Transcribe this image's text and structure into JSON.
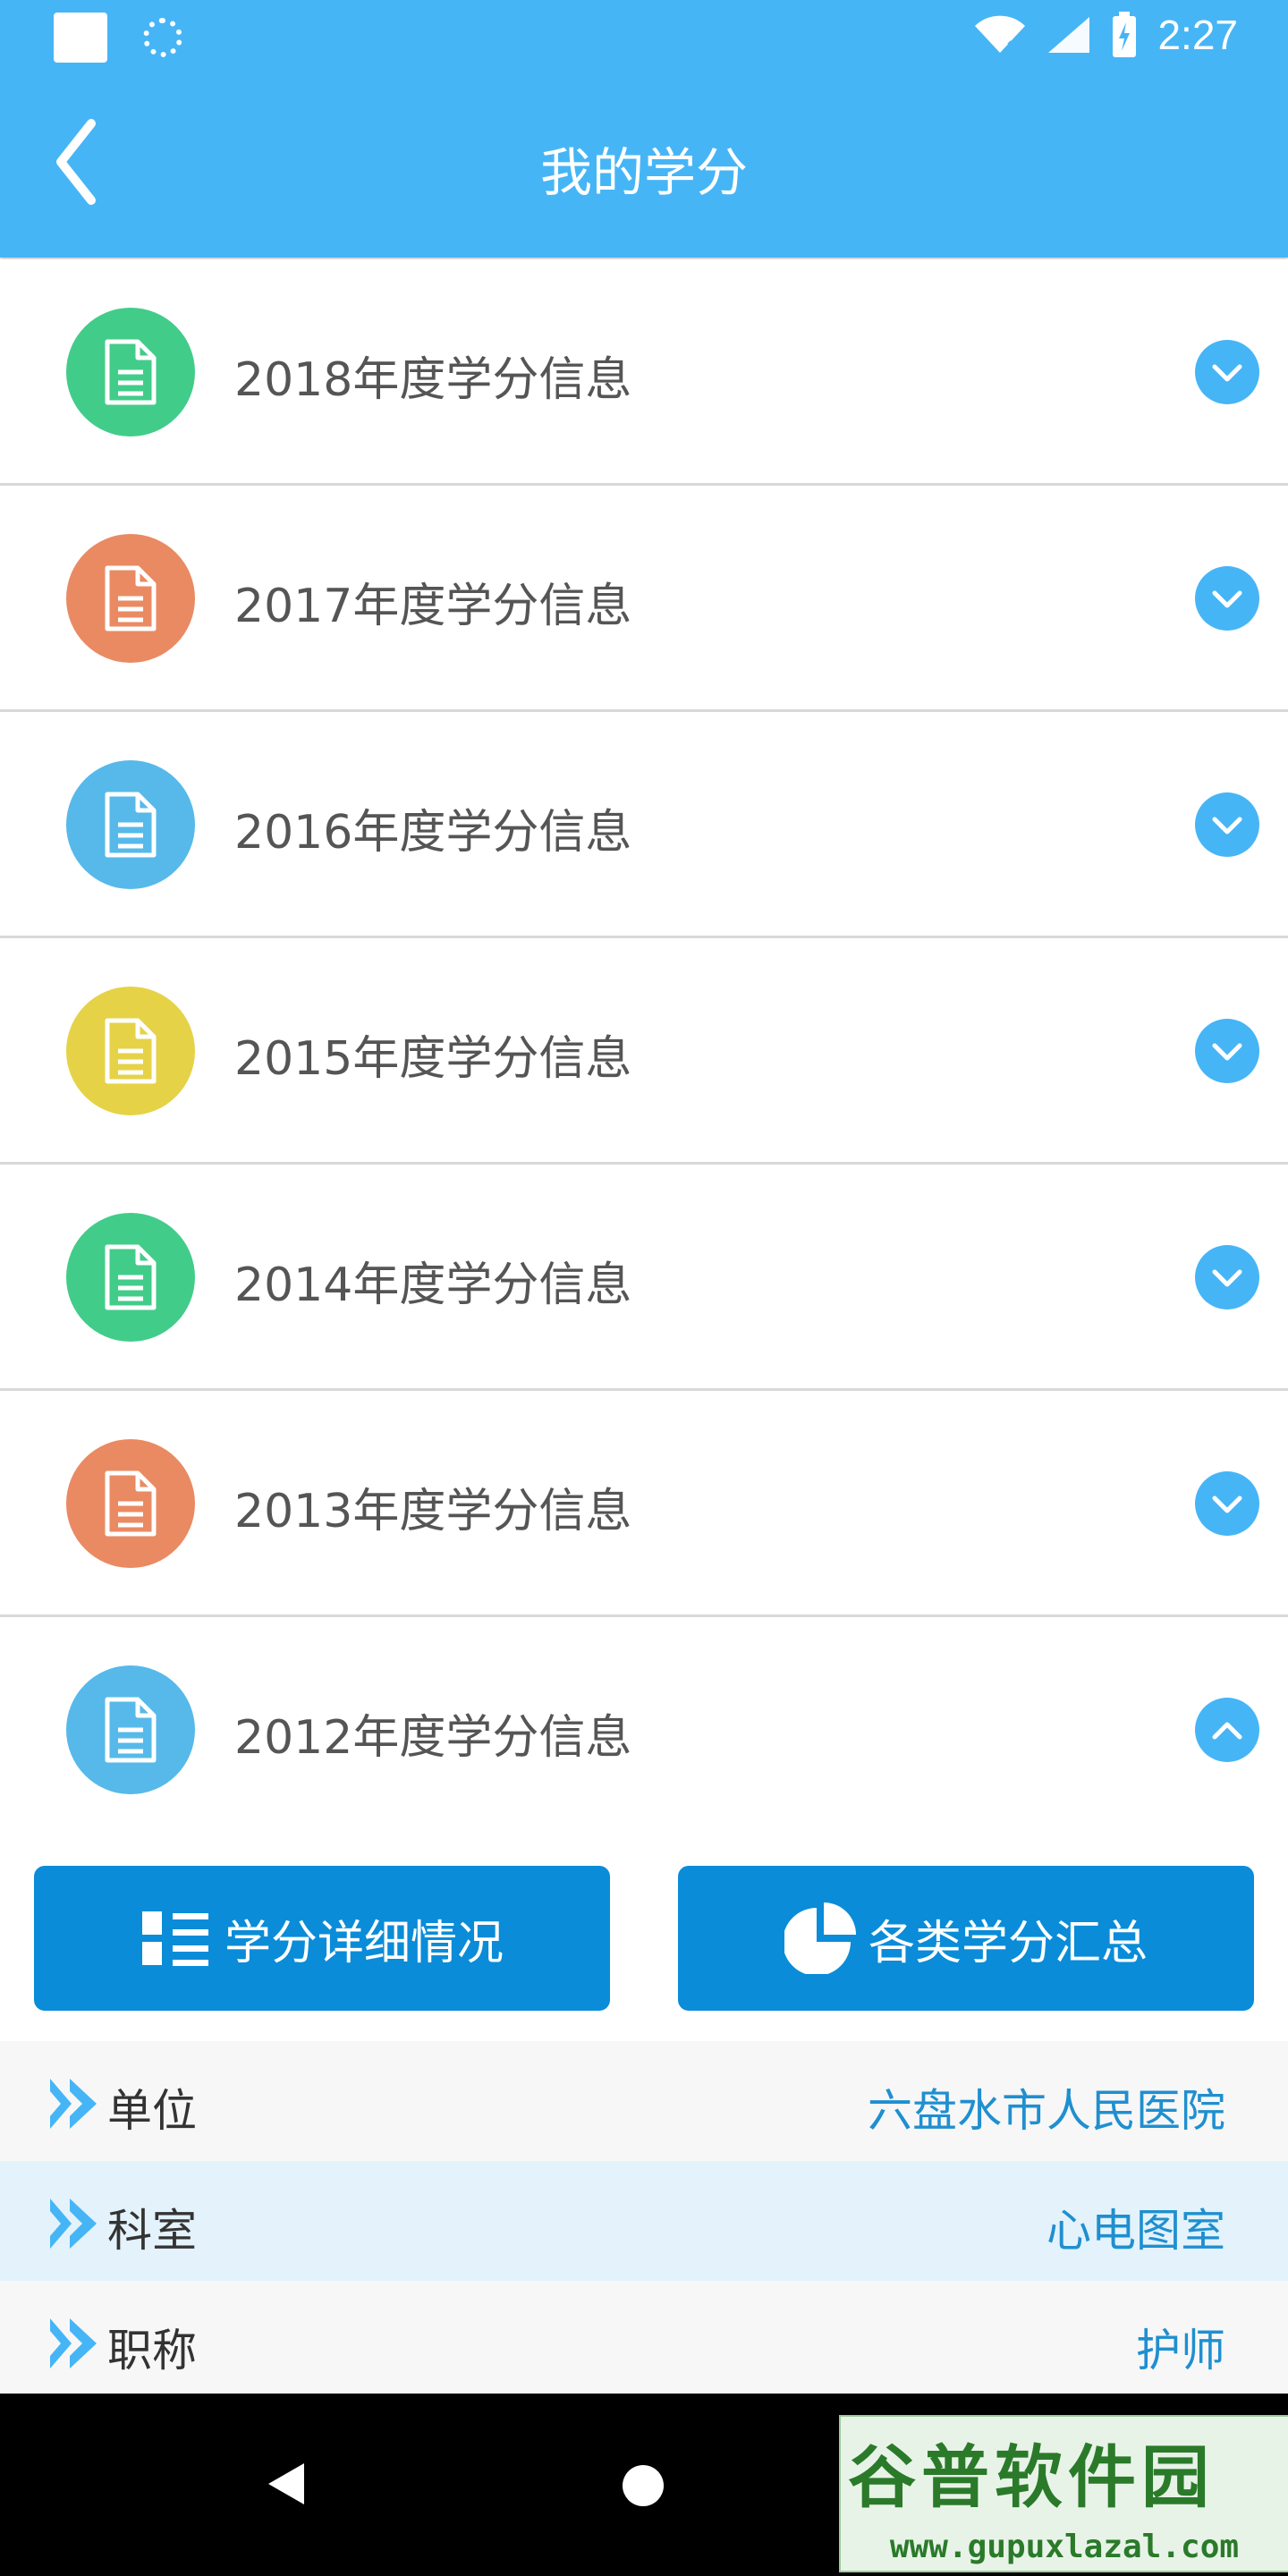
{
  "status_bar": {
    "time": "2:27"
  },
  "header": {
    "title": "我的学分"
  },
  "credit_years": [
    {
      "label": "2018年度学分信息",
      "color": "#42cc8a",
      "expanded": false
    },
    {
      "label": "2017年度学分信息",
      "color": "#ea8a62",
      "expanded": false
    },
    {
      "label": "2016年度学分信息",
      "color": "#56b9ea",
      "expanded": false
    },
    {
      "label": "2015年度学分信息",
      "color": "#e6d246",
      "expanded": false
    },
    {
      "label": "2014年度学分信息",
      "color": "#42cc8a",
      "expanded": false
    },
    {
      "label": "2013年度学分信息",
      "color": "#ea8a62",
      "expanded": false
    },
    {
      "label": "2012年度学分信息",
      "color": "#56b9ea",
      "expanded": true
    }
  ],
  "actions": {
    "detail_label": "学分详细情况",
    "summary_label": "各类学分汇总"
  },
  "info": [
    {
      "label": "单位",
      "value": "六盘水市人民医院"
    },
    {
      "label": "科室",
      "value": "心电图室"
    },
    {
      "label": "职称",
      "value": "护师"
    }
  ],
  "watermark": {
    "title": "谷普软件园",
    "url": "www.gupuxlazal.com"
  },
  "colors": {
    "primary": "#46b5f6",
    "button": "#0a8cd8",
    "value_text": "#1f8fd0"
  }
}
